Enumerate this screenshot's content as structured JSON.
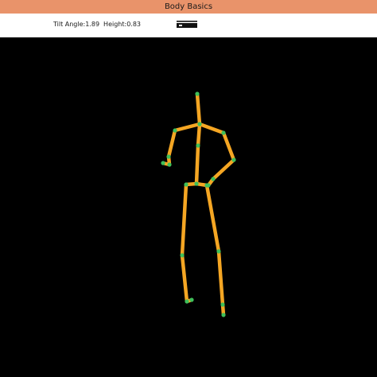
{
  "window": {
    "title": "Body Basics"
  },
  "info": {
    "tilt_label": "Tilt Angle:",
    "tilt_value": "1.89",
    "height_label": "Height:",
    "height_value": "0.83"
  },
  "icons": {
    "device": "kinect-sensor-icon"
  },
  "colors": {
    "titlebar": "#e9936a",
    "canvas_background": "#000000",
    "bone": "#f5a623",
    "joint": "#3ec05a"
  }
}
